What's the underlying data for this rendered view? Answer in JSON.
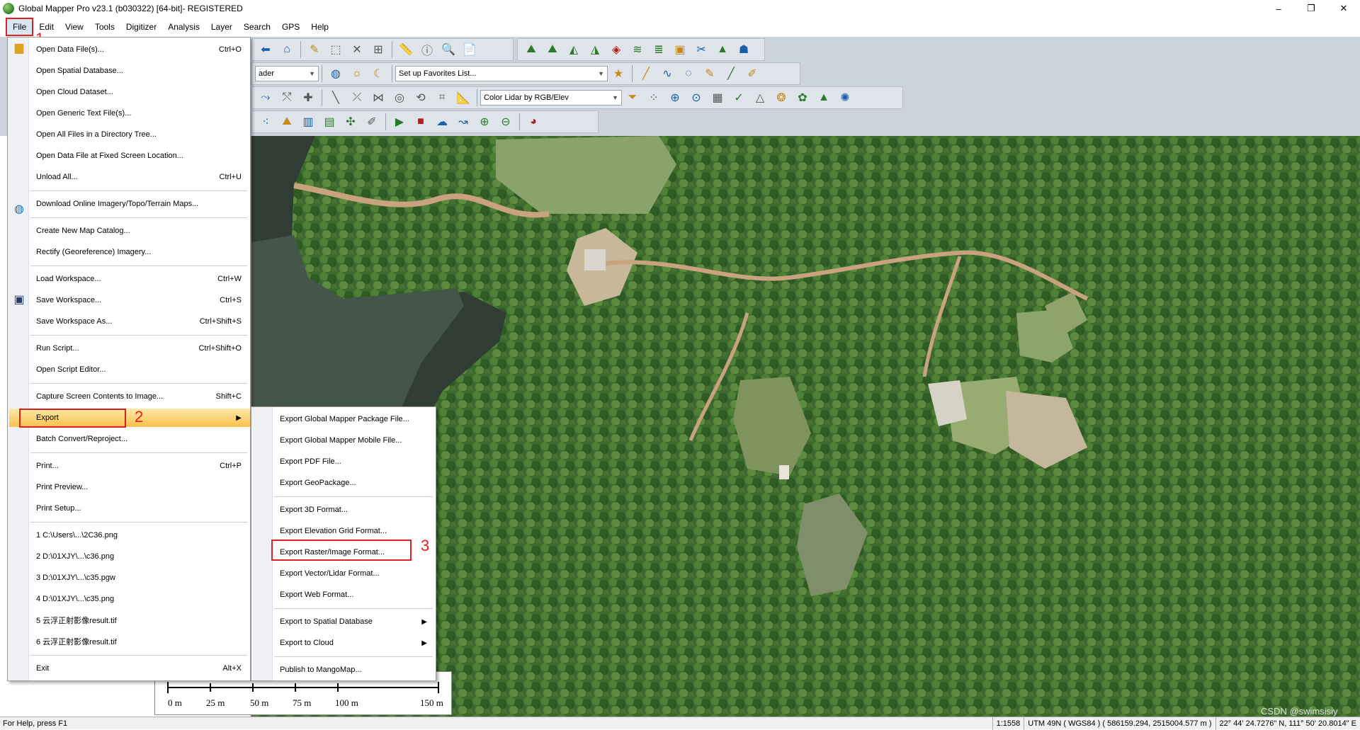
{
  "window": {
    "title": "Global Mapper Pro v23.1 (b030322) [64-bit]- REGISTERED",
    "min": "–",
    "max": "❐",
    "close": "✕"
  },
  "menubar": [
    "File",
    "Edit",
    "View",
    "Tools",
    "Digitizer",
    "Analysis",
    "Layer",
    "Search",
    "GPS",
    "Help"
  ],
  "toolbar": {
    "shader_partial": "ader",
    "favorites": "Set up Favorites List...",
    "lidar_color": "Color Lidar by RGB/Elev"
  },
  "file_menu": [
    {
      "label": "Open Data File(s)...",
      "shortcut": "Ctrl+O",
      "icon": "folder-icon"
    },
    {
      "label": "Open Spatial Database...",
      "shortcut": ""
    },
    {
      "label": "Open Cloud Dataset...",
      "shortcut": ""
    },
    {
      "label": "Open Generic Text File(s)...",
      "shortcut": ""
    },
    {
      "label": "Open All Files in a Directory Tree...",
      "shortcut": ""
    },
    {
      "label": "Open Data File at Fixed Screen Location...",
      "shortcut": ""
    },
    {
      "label": "Unload All...",
      "shortcut": "Ctrl+U"
    },
    {
      "label": "Download Online Imagery/Topo/Terrain Maps...",
      "shortcut": "",
      "icon": "globe-icon"
    },
    {
      "label": "Create New Map Catalog...",
      "shortcut": ""
    },
    {
      "label": "Rectify (Georeference) Imagery...",
      "shortcut": ""
    },
    {
      "label": "Load Workspace...",
      "shortcut": "Ctrl+W"
    },
    {
      "label": "Save Workspace...",
      "shortcut": "Ctrl+S",
      "icon": "save-icon"
    },
    {
      "label": "Save Workspace As...",
      "shortcut": "Ctrl+Shift+S"
    },
    {
      "label": "Run Script...",
      "shortcut": "Ctrl+Shift+O"
    },
    {
      "label": "Open Script Editor...",
      "shortcut": ""
    },
    {
      "label": "Capture Screen Contents to Image...",
      "shortcut": "Shift+C"
    },
    {
      "label": "Export",
      "shortcut": ""
    },
    {
      "label": "Batch Convert/Reproject...",
      "shortcut": ""
    },
    {
      "label": "Print...",
      "shortcut": "Ctrl+P"
    },
    {
      "label": "Print Preview...",
      "shortcut": ""
    },
    {
      "label": "Print Setup...",
      "shortcut": ""
    },
    {
      "label": "1 C:\\Users\\...\\2C36.png",
      "shortcut": ""
    },
    {
      "label": "2 D:\\01XJY\\...\\c36.png",
      "shortcut": ""
    },
    {
      "label": "3 D:\\01XJY\\...\\c35.pgw",
      "shortcut": ""
    },
    {
      "label": "4 D:\\01XJY\\...\\c35.png",
      "shortcut": ""
    },
    {
      "label": "5 云浮正射影像result.tif",
      "shortcut": ""
    },
    {
      "label": "6 云浮正射影像result.tif",
      "shortcut": ""
    },
    {
      "label": "Exit",
      "shortcut": "Alt+X"
    }
  ],
  "export_menu": [
    {
      "label": "Export Global Mapper Package File..."
    },
    {
      "label": "Export Global Mapper Mobile File..."
    },
    {
      "label": "Export PDF File..."
    },
    {
      "label": "Export GeoPackage..."
    },
    {
      "label": "Export 3D Format..."
    },
    {
      "label": "Export Elevation Grid Format..."
    },
    {
      "label": "Export Raster/Image Format..."
    },
    {
      "label": "Export Vector/Lidar Format..."
    },
    {
      "label": "Export Web Format..."
    },
    {
      "label": "Export to Spatial Database"
    },
    {
      "label": "Export to Cloud"
    },
    {
      "label": "Publish to MangoMap..."
    }
  ],
  "annotations": {
    "n1": "1",
    "n2": "2",
    "n3": "3"
  },
  "scalebar": [
    "0 m",
    "25 m",
    "50 m",
    "75 m",
    "100 m",
    "150 m"
  ],
  "status": {
    "help": "For Help, press F1",
    "scale": "1:1558",
    "proj": "UTM 49N ( WGS84 ) ( 586159.294, 2515004.577 m )",
    "latlon": "22° 44' 24.7276\" N, 111° 50' 20.8014\" E",
    "watermark": "CSDN @swimsisiy"
  },
  "colors": {
    "accent": "#e02020",
    "highlight": "#f7c14c"
  }
}
